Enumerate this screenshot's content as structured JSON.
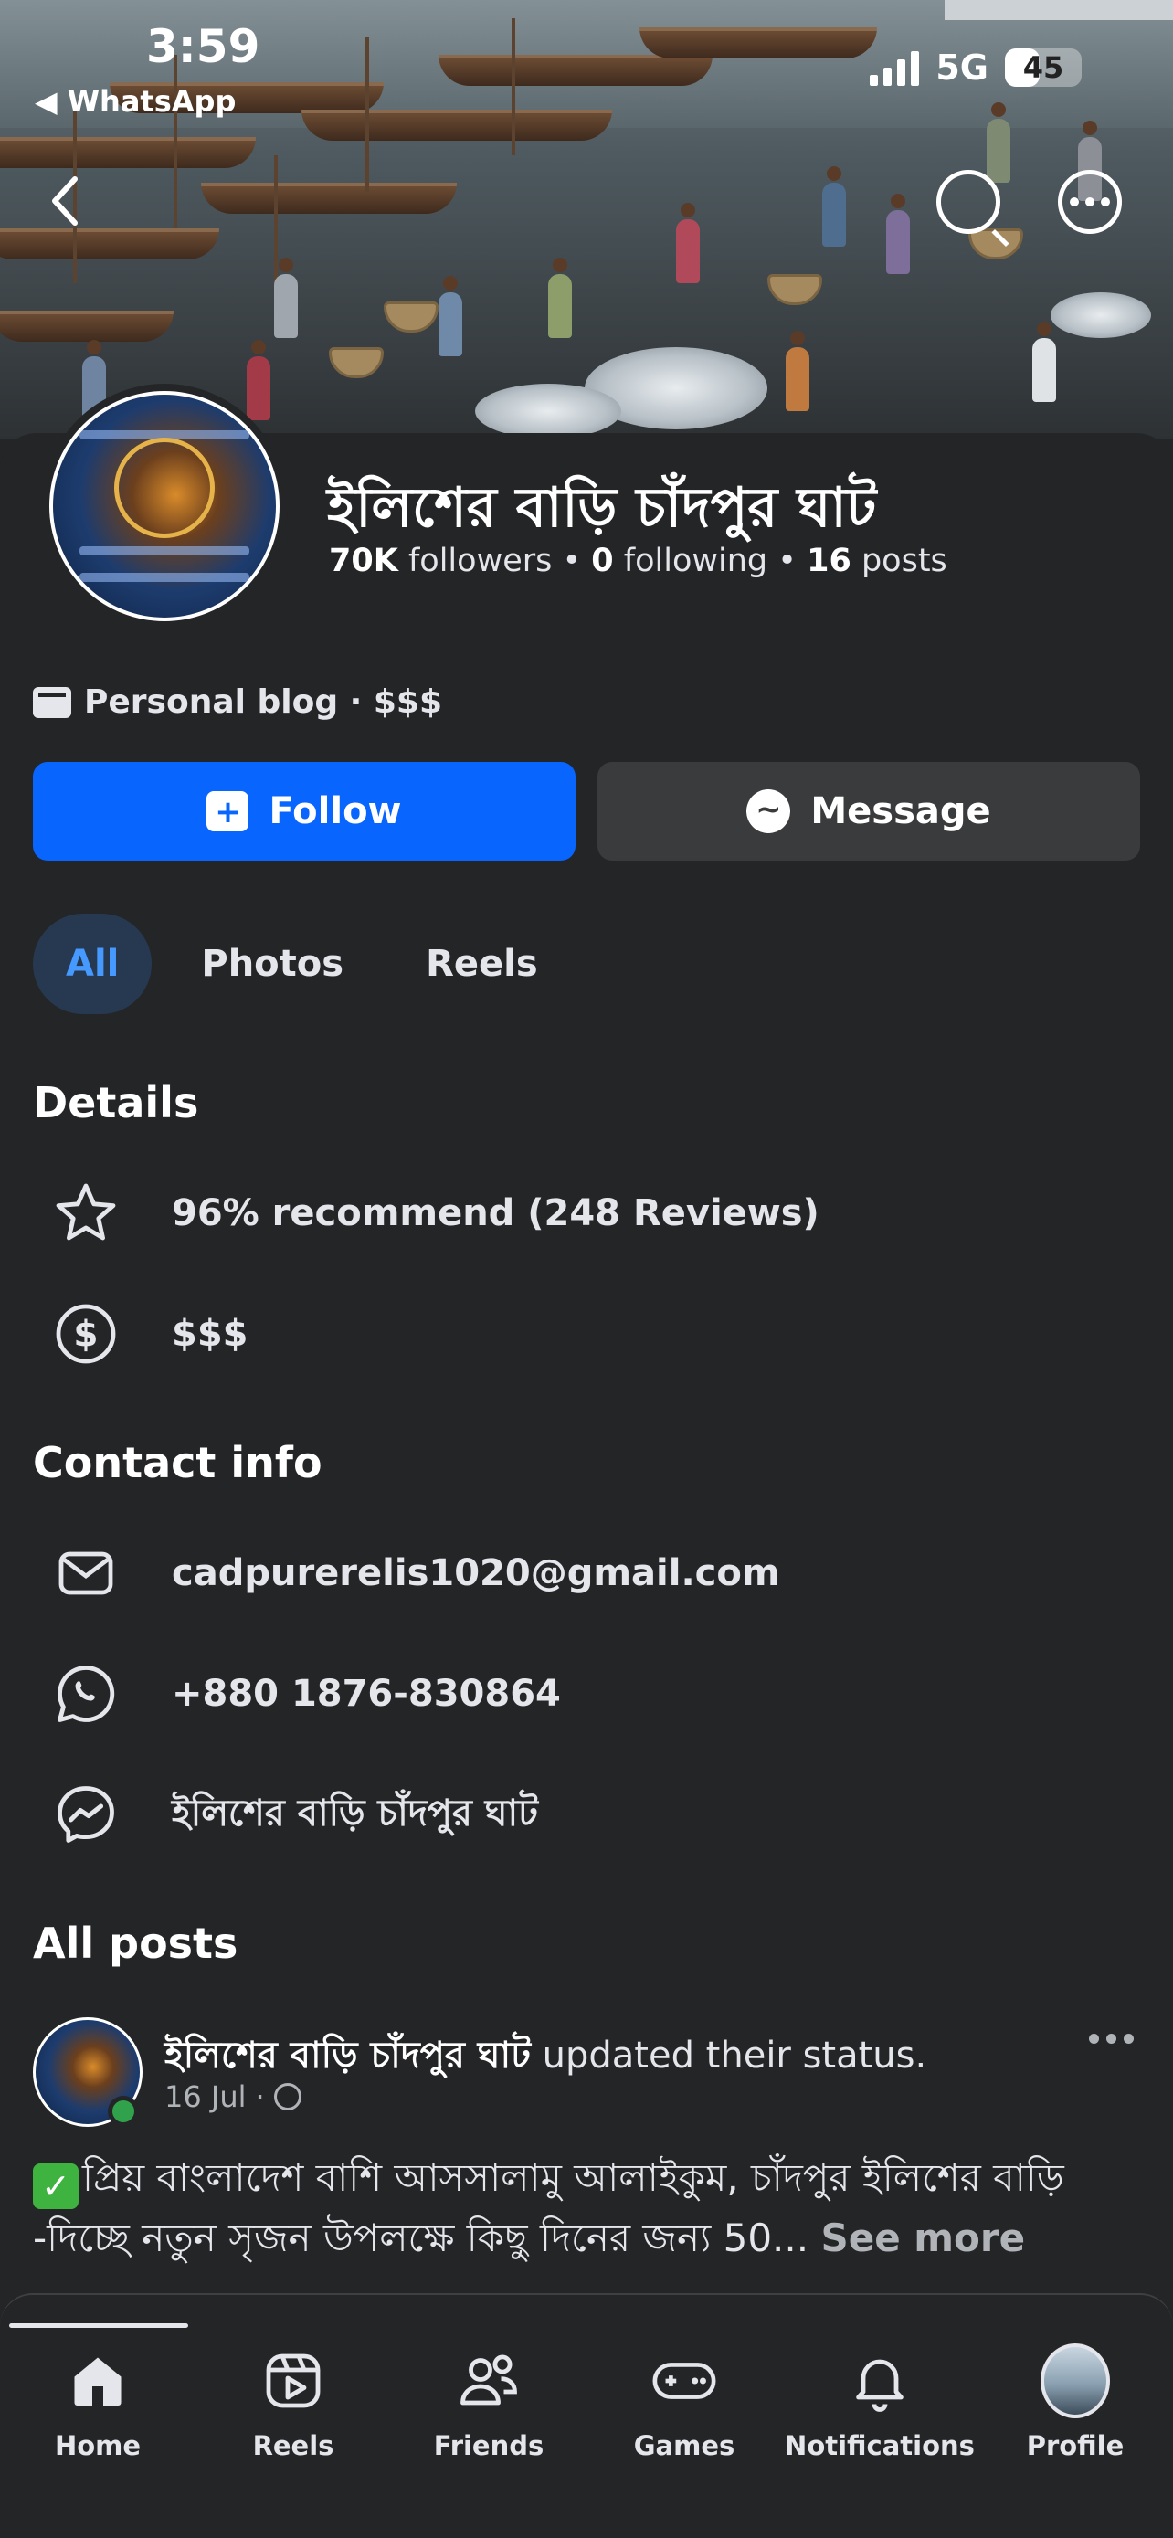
{
  "status_bar": {
    "time": "3:59",
    "back_app": "◀ WhatsApp",
    "network": "5G",
    "battery": "45",
    "battery_level_percent": 45
  },
  "page": {
    "name": "ইলিশের বাড়ি চাঁদপুর ঘাট",
    "followers_count": "70K",
    "followers_label": "followers",
    "following_count": "0",
    "following_label": "following",
    "posts_count": "16",
    "posts_label": "posts",
    "separator": "•",
    "category": "Personal blog · $$$"
  },
  "actions": {
    "follow_label": "Follow",
    "message_label": "Message"
  },
  "tabs": [
    {
      "label": "All",
      "active": true
    },
    {
      "label": "Photos",
      "active": false
    },
    {
      "label": "Reels",
      "active": false
    }
  ],
  "details": {
    "title": "Details",
    "recommend": "96% recommend (248 Reviews)",
    "price": "$$$"
  },
  "contact": {
    "title": "Contact info",
    "email": "cadpurerelis1020@gmail.com",
    "phone": "+880 1876-830864",
    "messenger": "ইলিশের বাড়ি চাঁদপুর ঘাট"
  },
  "posts": {
    "title": "All posts",
    "author": "ইলিশের বাড়ি চাঁদপুর ঘাট",
    "action": "updated their status.",
    "date": "16 Jul",
    "date_sep": "·",
    "text": "প্রিয় বাংলাদেশ বাশি আসসালামু আলাইকুম, চাঁদপুর ইলিশের বাড়ি -দিচ্ছে নতুন সৃজন উপলক্ষে কিছু দিনের  জন্য 50... ",
    "see_more": "See more"
  },
  "bottom_nav": [
    {
      "label": "Home",
      "icon": "home-icon",
      "active": true
    },
    {
      "label": "Reels",
      "icon": "reels-icon",
      "active": false
    },
    {
      "label": "Friends",
      "icon": "friends-icon",
      "active": false
    },
    {
      "label": "Games",
      "icon": "games-icon",
      "active": false
    },
    {
      "label": "Notifications",
      "icon": "bell-icon",
      "active": false
    },
    {
      "label": "Profile",
      "icon": "profile-avatar",
      "active": false
    }
  ],
  "colors": {
    "background": "#242526",
    "follow_button": "#0866ff",
    "message_button": "#3a3b3c",
    "active_tab_bg": "#263951",
    "active_tab_text": "#4599ff",
    "online_dot": "#31a24c"
  }
}
